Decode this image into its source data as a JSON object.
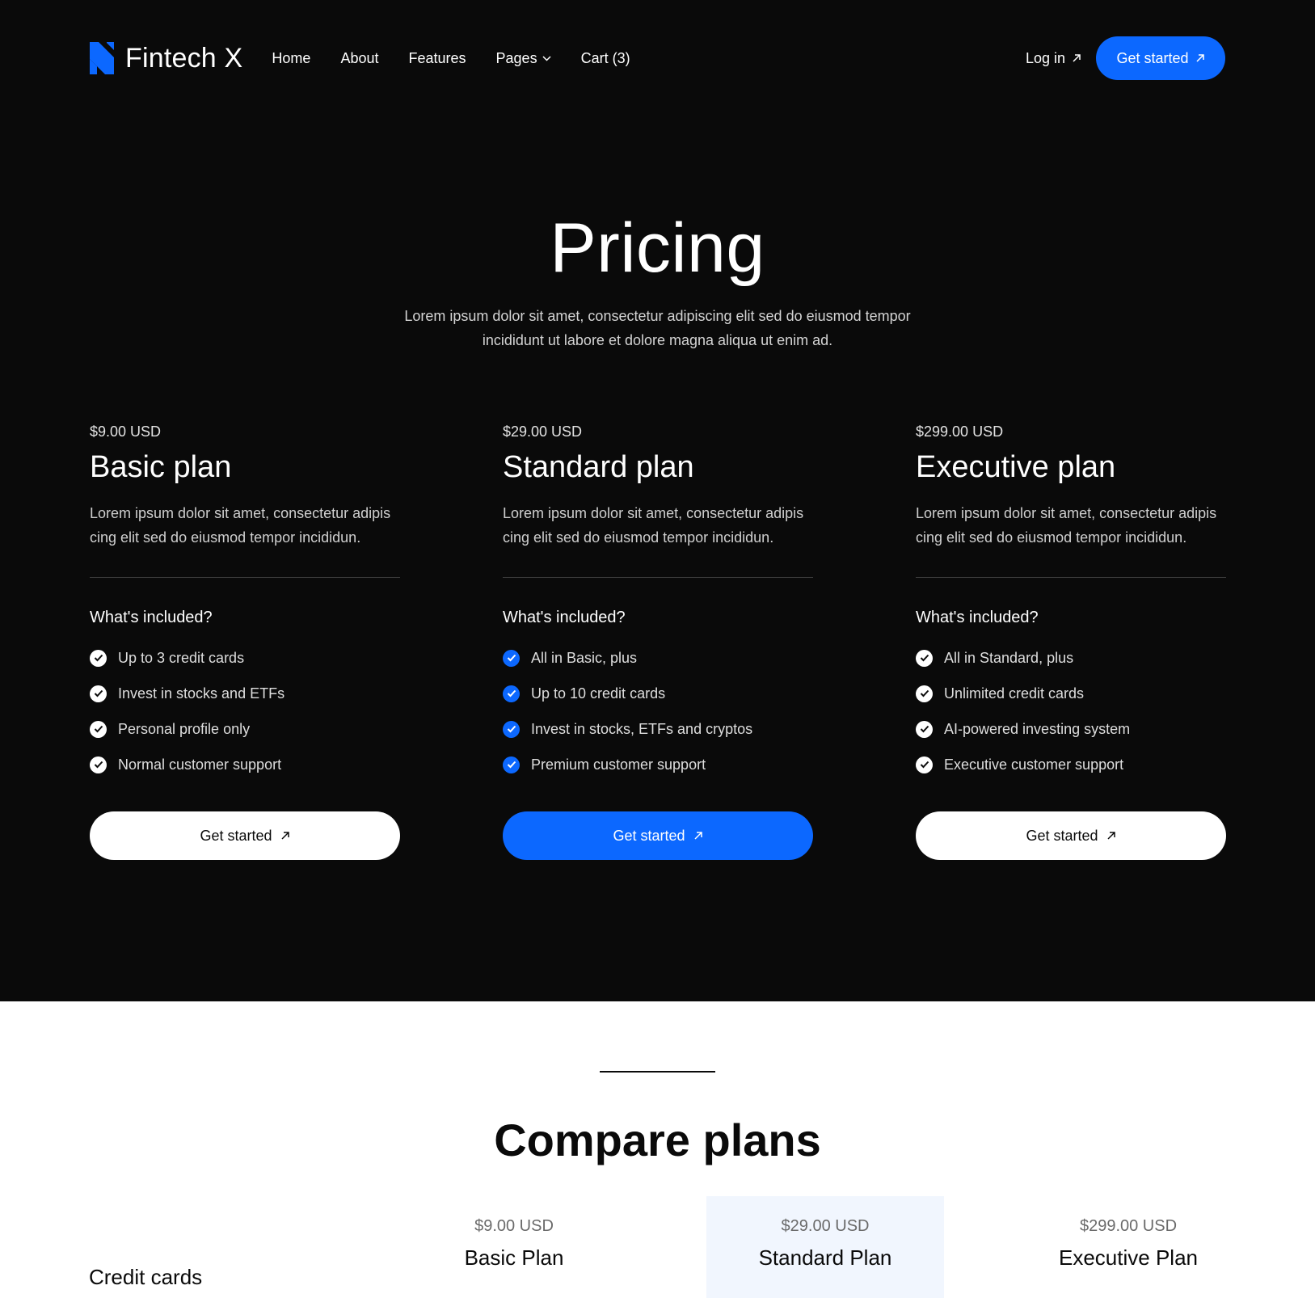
{
  "brand": {
    "name": "Fintech X",
    "accent": "#0c68ff",
    "background": "#0a0a0a"
  },
  "nav": {
    "links": [
      "Home",
      "About",
      "Features",
      "Pages",
      "Cart (3)"
    ],
    "login": "Log in",
    "cta": "Get started"
  },
  "hero": {
    "title": "Pricing",
    "subtitle": "Lorem ipsum dolor sit amet, consectetur adipiscing elit sed do eiusmod tempor incididunt ut labore et dolore magna aliqua ut enim ad."
  },
  "plans": [
    {
      "price": "$9.00 USD",
      "name": "Basic plan",
      "description": "Lorem ipsum dolor sit amet, consectetur adipis cing elit sed do eiusmod tempor incididun.",
      "included_title": "What's included?",
      "features": [
        "Up to 3 credit cards",
        "Invest in stocks and ETFs",
        "Personal profile only",
        "Normal customer support"
      ],
      "button": "Get started",
      "check_color": "white",
      "button_style": "white"
    },
    {
      "price": "$29.00 USD",
      "name": "Standard plan",
      "description": "Lorem ipsum dolor sit amet, consectetur adipis cing elit sed do eiusmod tempor incididun.",
      "included_title": "What's included?",
      "features": [
        "All in Basic, plus",
        "Up to 10 credit cards",
        "Invest in stocks, ETFs and cryptos",
        "Premium customer support"
      ],
      "button": "Get started",
      "check_color": "blue",
      "button_style": "blue"
    },
    {
      "price": "$299.00 USD",
      "name": "Executive plan",
      "description": "Lorem ipsum dolor sit amet, consectetur adipis cing elit sed do eiusmod tempor incididun.",
      "included_title": "What's included?",
      "features": [
        "All in Standard, plus",
        "Unlimited credit cards",
        "AI-powered investing system",
        "Executive customer support"
      ],
      "button": "Get started",
      "check_color": "white",
      "button_style": "white"
    }
  ],
  "compare": {
    "title": "Compare plans",
    "row_label": "Credit cards",
    "columns": [
      {
        "price": "$9.00 USD",
        "name": "Basic Plan"
      },
      {
        "price": "$29.00 USD",
        "name": "Standard Plan"
      },
      {
        "price": "$299.00 USD",
        "name": "Executive Plan"
      }
    ]
  }
}
